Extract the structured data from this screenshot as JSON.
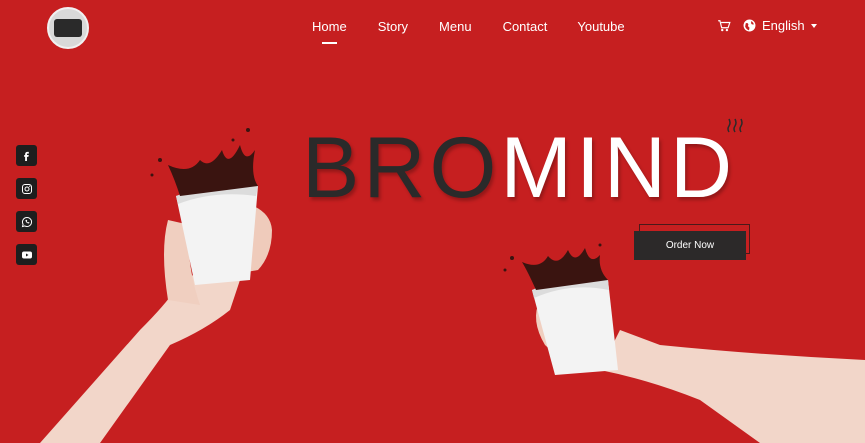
{
  "brand": {
    "logo_text": "BROMIND"
  },
  "nav": {
    "items": [
      {
        "label": "Home",
        "active": true
      },
      {
        "label": "Story",
        "active": false
      },
      {
        "label": "Menu",
        "active": false
      },
      {
        "label": "Contact",
        "active": false
      },
      {
        "label": "Youtube",
        "active": false
      }
    ]
  },
  "tools": {
    "cart_icon": "cart-icon",
    "globe_icon": "globe-icon",
    "language": "English"
  },
  "social": [
    {
      "name": "facebook-icon"
    },
    {
      "name": "instagram-icon"
    },
    {
      "name": "whatsapp-icon"
    },
    {
      "name": "youtube-icon"
    }
  ],
  "hero": {
    "title_dark": "BRO",
    "title_light": "MIND",
    "cta_label": "Order Now"
  },
  "colors": {
    "background": "#c61f20",
    "dark": "#2a2a2a",
    "button": "#2c2929"
  }
}
